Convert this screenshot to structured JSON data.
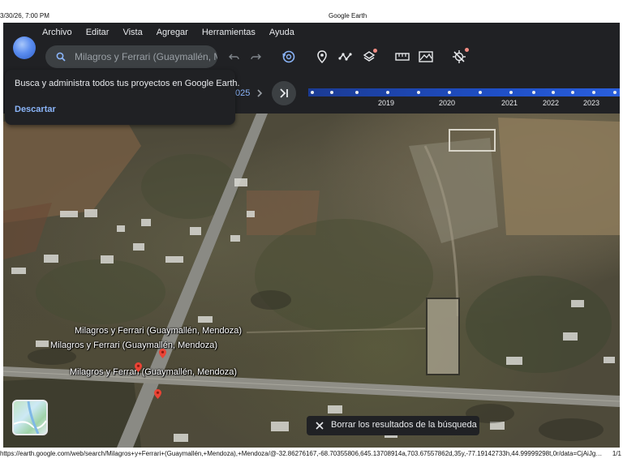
{
  "print_header": {
    "timestamp": "3/30/26, 7:00 PM",
    "title": "Google Earth"
  },
  "print_footer": {
    "url": "https://earth.google.com/web/search/Milagros+y+Ferrari+(Guaymallén,+Mendoza),+Mendoza/@-32.86276167,-68.70355806,645.13708914a,703.67557862d,35y,-77.19142733h,44.99999298t,0r/data=CjAiJgokCbjzx...",
    "page": "1/1"
  },
  "menu": [
    "Archivo",
    "Editar",
    "Vista",
    "Agregar",
    "Herramientas",
    "Ayuda"
  ],
  "search": {
    "value": "Milagros y Ferrari (Guaymallén, M"
  },
  "tooltip": {
    "text": "Busca y administra todos tus proyectos en Google Earth.",
    "dismiss": "Descartar"
  },
  "timeline": {
    "current_fragment": "025",
    "years": [
      "2019",
      "2020",
      "2021",
      "2022",
      "2023"
    ]
  },
  "map": {
    "labels": [
      "Milagros y Ferrari (Guaymallén, Mendoza)",
      "Milagros y Ferrari (Guaymallén, Mendoza)",
      "Milagros y Ferrari (Guaymallén, Mendoza)"
    ]
  },
  "snackbar": {
    "text": "Borrar los resultados de la búsqueda"
  },
  "colors": {
    "toolbar": "#202124",
    "accent": "#8ab4f8",
    "pin": "#ea4335",
    "timeline": "#1f4fc6"
  },
  "icons": [
    "search-icon",
    "undo-icon",
    "redo-icon",
    "history-icon",
    "location-pin-icon",
    "path-icon",
    "layers-icon",
    "ruler-icon",
    "elevation-icon",
    "no-gps-icon",
    "skip-end-icon",
    "chevron-right-icon",
    "close-icon"
  ]
}
